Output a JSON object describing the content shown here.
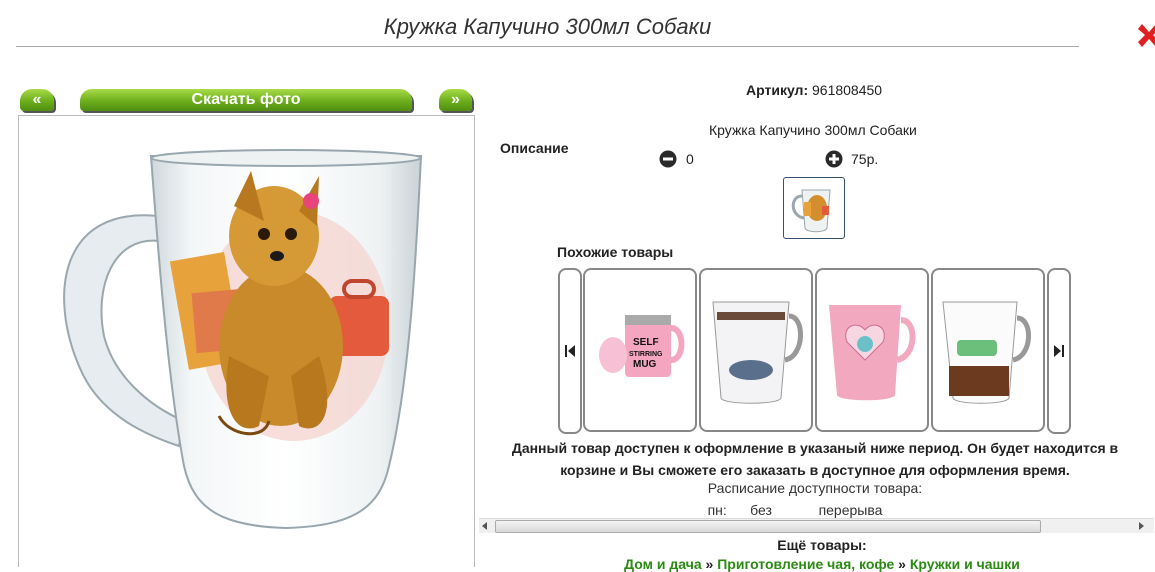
{
  "product_title": "Кружка Капучино 300мл Собаки",
  "gallery": {
    "prev": "«",
    "download": "Скачать фото",
    "next": "»"
  },
  "article": {
    "label": "Артикул:",
    "value": "961808450"
  },
  "description": {
    "label": "Описание",
    "text": "Кружка Капучино 300мл Собаки"
  },
  "quantity": {
    "value": "0",
    "price": "75р."
  },
  "similar": {
    "title": "Похожие товары",
    "items": [
      {
        "name": "self-stirring-mug",
        "text_line1": "SELF",
        "text_line2": "STIRRING",
        "text_line3": "MUG"
      },
      {
        "name": "fashion-mug"
      },
      {
        "name": "pink-heart-mug"
      },
      {
        "name": "car-mug"
      }
    ]
  },
  "notice": "Данный товар доступен к оформление в указаный ниже период. Он будет находится в корзине и Вы сможете его заказать в доступное для оформления время.",
  "schedule": {
    "title": "Расписание доступности товара:",
    "day": "пн:",
    "mode": "без",
    "break": "перерыва"
  },
  "more": {
    "label": "Ещё товары:",
    "crumbs": [
      "Дом и дача",
      "Приготовление чая, кофе",
      "Кружки и чашки"
    ],
    "sep": "»"
  },
  "colors": {
    "accent_green": "#6cae1b",
    "link_green": "#2a8a12",
    "close_red": "#e02020"
  }
}
